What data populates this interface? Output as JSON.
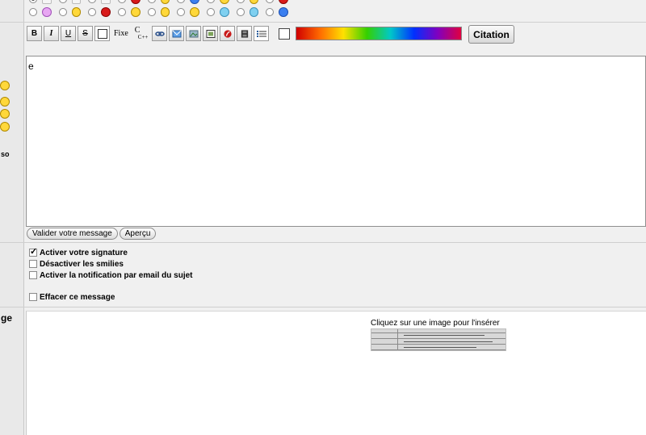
{
  "left_column": {
    "frag_so": "so",
    "frag_ge": "ge"
  },
  "smiley_panel": {
    "row1": [
      "sq",
      "sq",
      "sq",
      "red",
      "sq",
      "blue",
      "yellow",
      "yellow",
      "red"
    ],
    "row2": [
      "purple",
      "yellow",
      "red",
      "yellow",
      "yellow",
      "yellow",
      "teal",
      "teal",
      "blue"
    ]
  },
  "toolbar": {
    "bold": "B",
    "italic": "I",
    "underline": "U",
    "strike": "S",
    "fixed": "Fixe",
    "cpp": "C",
    "cpp_sub": "C++",
    "quote_button": "Citation"
  },
  "colors": {
    "spectrum_start": "#d00000",
    "spectrum_end": "#e00040"
  },
  "editor": {
    "text": "e"
  },
  "buttons": {
    "submit": "Valider votre message",
    "preview": "Aperçu"
  },
  "options": {
    "signature": {
      "label": "Activer votre signature",
      "checked": true
    },
    "no_smilies": {
      "label": "Désactiver les smilies",
      "checked": false
    },
    "notify": {
      "label": "Activer la notification par email du sujet",
      "checked": false
    },
    "delete": {
      "label": "Effacer ce message",
      "checked": false
    }
  },
  "image_panel": {
    "caption": "Cliquez sur une image pour l'insérer"
  }
}
